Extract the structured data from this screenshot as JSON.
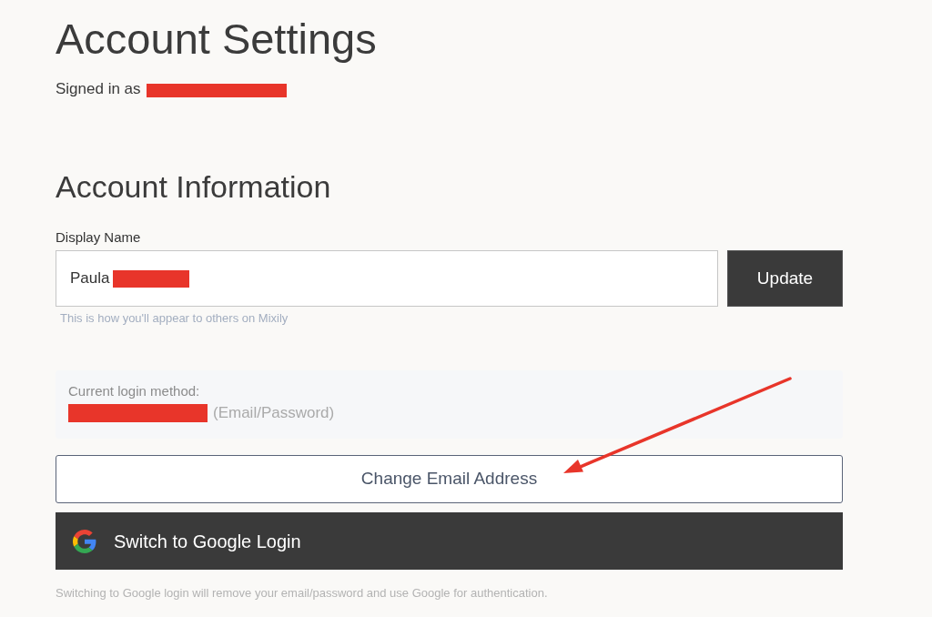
{
  "header": {
    "title": "Account Settings",
    "signed_in": {
      "label": "Signed in as",
      "redacted": true
    }
  },
  "account_information": {
    "heading": "Account Information",
    "display_name": {
      "label": "Display Name",
      "value": "Paula",
      "redacted": true,
      "hint": "This is how you'll appear to others on Mixily"
    },
    "update_button": "Update"
  },
  "login_method": {
    "label": "Current login method:",
    "redacted": true,
    "detail": "(Email/Password)"
  },
  "buttons": [
    {
      "kind": "outline",
      "label": "Change Email Address"
    },
    {
      "kind": "google",
      "label": "Switch to Google Login"
    }
  ],
  "note": "Switching to Google login will remove your email/password and use Google for authentication."
}
